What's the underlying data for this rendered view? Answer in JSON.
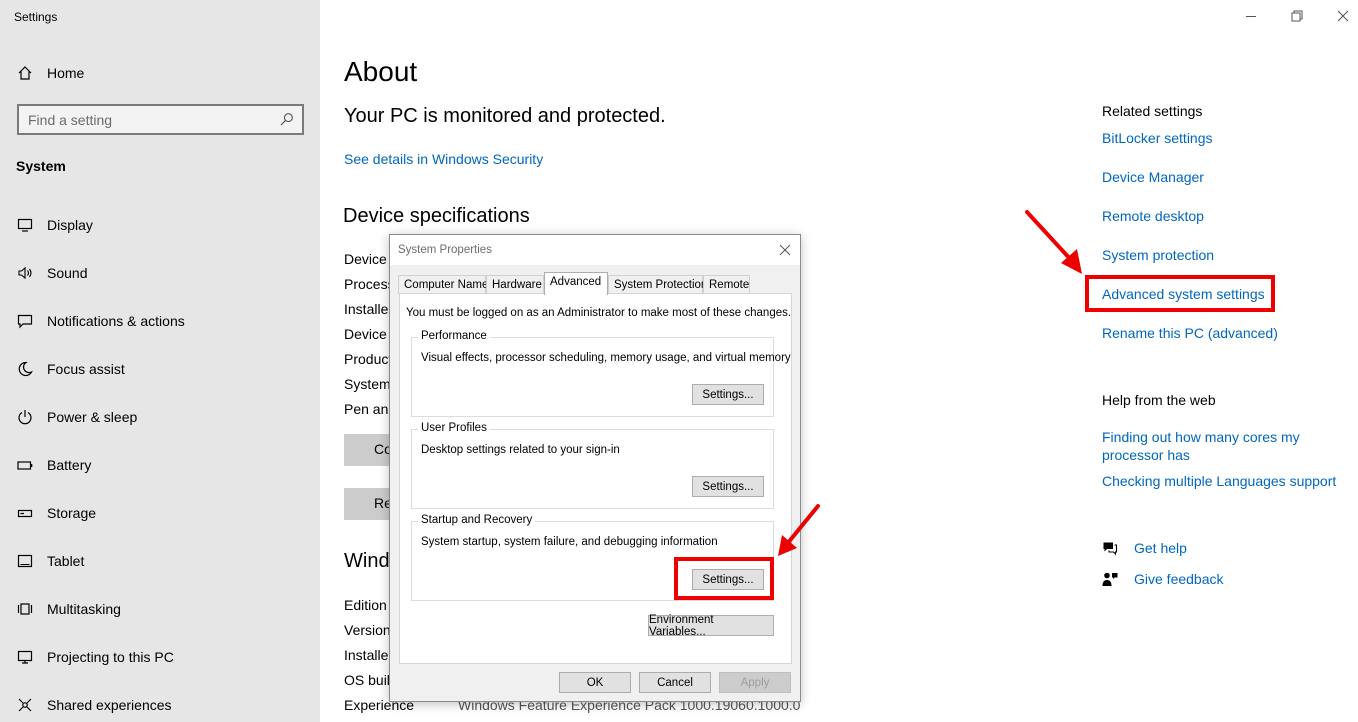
{
  "window": {
    "title": "Settings"
  },
  "sidebar": {
    "home_label": "Home",
    "search_placeholder": "Find a setting",
    "section_header": "System",
    "items": [
      {
        "label": "Display",
        "icon": "monitor-icon"
      },
      {
        "label": "Sound",
        "icon": "speaker-icon"
      },
      {
        "label": "Notifications & actions",
        "icon": "message-icon"
      },
      {
        "label": "Focus assist",
        "icon": "moon-icon"
      },
      {
        "label": "Power & sleep",
        "icon": "power-icon"
      },
      {
        "label": "Battery",
        "icon": "battery-icon"
      },
      {
        "label": "Storage",
        "icon": "storage-icon"
      },
      {
        "label": "Tablet",
        "icon": "tablet-icon"
      },
      {
        "label": "Multitasking",
        "icon": "multitask-icon"
      },
      {
        "label": "Projecting to this PC",
        "icon": "projector-icon"
      },
      {
        "label": "Shared experiences",
        "icon": "share-icon"
      }
    ]
  },
  "main": {
    "title": "About",
    "protection_text": "Your PC is monitored and protected.",
    "security_link": "See details in Windows Security",
    "device_spec_heading": "Device specifications",
    "spec_labels": [
      "Device",
      "Process",
      "Installe",
      "Device",
      "Product",
      "System",
      "Pen and"
    ],
    "copy_button": "Co",
    "rename_button": "Rena",
    "windows_spec_heading": "Wind",
    "windows_labels": [
      "Edition",
      "Version",
      "Installe",
      "OS buil",
      "Experience"
    ],
    "experience_value": "Windows Feature Experience Pack 1000.19060.1000.0"
  },
  "related": {
    "heading": "Related settings",
    "links": [
      "BitLocker settings",
      "Device Manager",
      "Remote desktop",
      "System protection",
      "Advanced system settings",
      "Rename this PC (advanced)"
    ],
    "help_heading": "Help from the web",
    "help_link_1": "Finding out how many cores my processor has",
    "help_link_2": "Checking multiple Languages support",
    "get_help": "Get help",
    "give_feedback": "Give feedback"
  },
  "dialog": {
    "title": "System Properties",
    "tabs": [
      "Computer Name",
      "Hardware",
      "Advanced",
      "System Protection",
      "Remote"
    ],
    "active_tab": "Advanced",
    "admin_note": "You must be logged on as an Administrator to make most of these changes.",
    "groups": [
      {
        "label": "Performance",
        "desc": "Visual effects, processor scheduling, memory usage, and virtual memory",
        "button": "Settings..."
      },
      {
        "label": "User Profiles",
        "desc": "Desktop settings related to your sign-in",
        "button": "Settings..."
      },
      {
        "label": "Startup and Recovery",
        "desc": "System startup, system failure, and debugging information",
        "button": "Settings..."
      }
    ],
    "env_button": "Environment Variables...",
    "ok": "OK",
    "cancel": "Cancel",
    "apply": "Apply"
  },
  "colors": {
    "link": "#0067c0",
    "highlight": "#ee0000",
    "sidebar_bg": "#e6e6e6"
  }
}
